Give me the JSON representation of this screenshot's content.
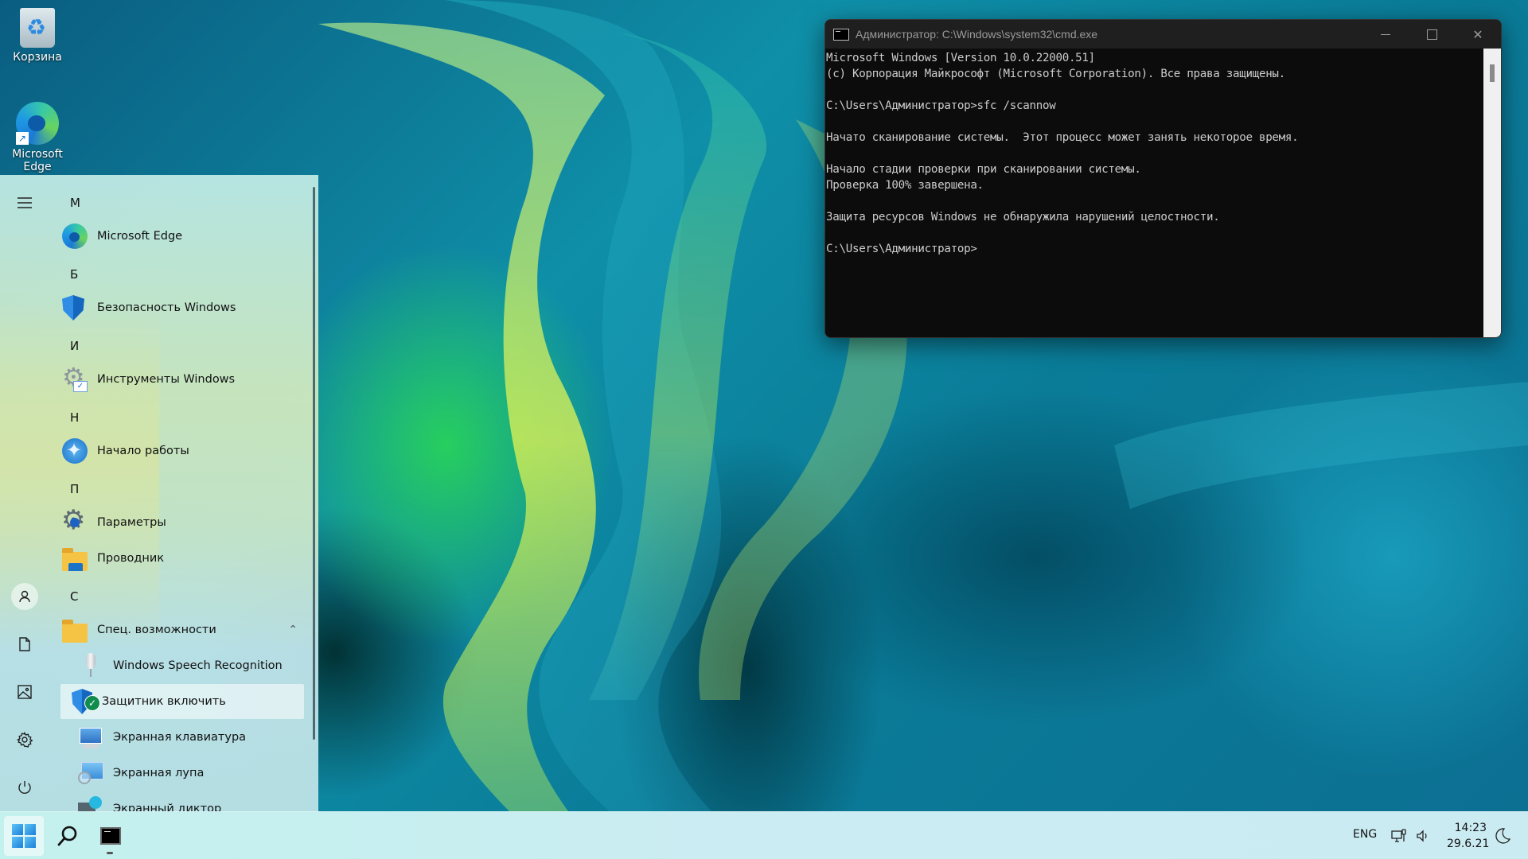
{
  "desktop": {
    "icons": [
      {
        "label": "Корзина",
        "icon": "recycle-bin-icon"
      },
      {
        "label": "Microsoft Edge",
        "icon": "edge-icon"
      }
    ]
  },
  "start_menu": {
    "nav": [
      {
        "name": "hamburger-menu",
        "icon": "menu-icon"
      },
      {
        "name": "user",
        "icon": "user-icon"
      },
      {
        "name": "documents",
        "icon": "document-icon"
      },
      {
        "name": "pictures",
        "icon": "picture-icon"
      },
      {
        "name": "settings",
        "icon": "gear-icon"
      },
      {
        "name": "power",
        "icon": "power-icon"
      }
    ],
    "letters": [
      "M",
      "Б",
      "И",
      "Н",
      "П",
      "С"
    ],
    "apps": [
      {
        "label": "Microsoft Edge",
        "icon": "edge-icon"
      },
      {
        "label": "Безопасность Windows",
        "icon": "shield-icon"
      },
      {
        "label": "Инструменты Windows",
        "icon": "tools-icon"
      },
      {
        "label": "Начало работы",
        "icon": "get-started-icon"
      },
      {
        "label": "Параметры",
        "icon": "settings-icon"
      },
      {
        "label": "Проводник",
        "icon": "explorer-icon"
      },
      {
        "label": "Спец. возможности",
        "icon": "folder-icon",
        "expanded": true
      },
      {
        "label": "Windows Speech Recognition",
        "icon": "microphone-icon"
      },
      {
        "label": "Защитник включить",
        "icon": "defender-icon",
        "selected": true
      },
      {
        "label": "Экранная клавиатура",
        "icon": "keyboard-icon"
      },
      {
        "label": "Экранная лупа",
        "icon": "magnifier-icon"
      },
      {
        "label": "Экранный диктор",
        "icon": "narrator-icon"
      }
    ]
  },
  "cmd_window": {
    "title": "Администратор: C:\\Windows\\system32\\cmd.exe",
    "lines": [
      "Microsoft Windows [Version 10.0.22000.51]",
      "(c) Корпорация Майкрософт (Microsoft Corporation). Все права защищены.",
      "",
      "C:\\Users\\Администратор>sfc /scannow",
      "",
      "Начато сканирование системы.  Этот процесс может занять некоторое время.",
      "",
      "Начало стадии проверки при сканировании системы.",
      "Проверка 100% завершена.",
      "",
      "Защита ресурсов Windows не обнаружила нарушений целостности.",
      "",
      "C:\\Users\\Администратор>"
    ]
  },
  "taskbar": {
    "pinned": [
      {
        "name": "start",
        "icon": "windows-logo-icon"
      },
      {
        "name": "search",
        "icon": "search-icon"
      },
      {
        "name": "cmd",
        "icon": "cmd-icon",
        "running": true
      }
    ],
    "tray": {
      "language": "ENG",
      "time": "14:23",
      "date": "29.6.21"
    }
  },
  "colors": {
    "taskbar_bg": "#c8eef0",
    "cmd_bg": "#0c0c0c",
    "cmd_text": "#cccccc",
    "accent": "#1b7fd8"
  }
}
